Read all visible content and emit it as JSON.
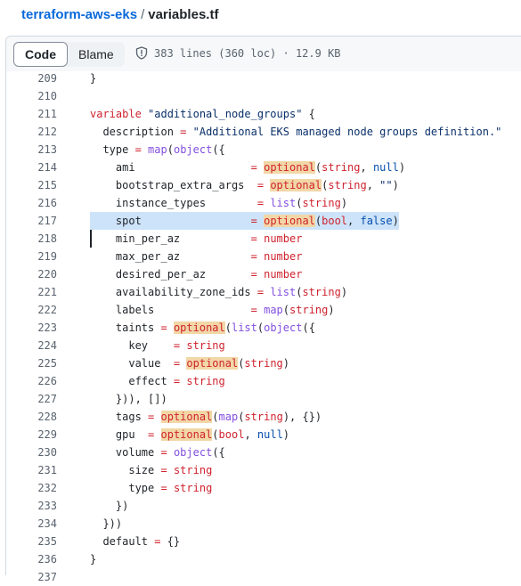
{
  "breadcrumb": {
    "repo": "terraform-aws-eks",
    "separator": "/",
    "file": "variables.tf"
  },
  "tabs": [
    {
      "label": "Code",
      "active": true
    },
    {
      "label": "Blame",
      "active": false
    }
  ],
  "file_meta": "383 lines (360 loc) · 12.9 KB",
  "highlighted_line": 217,
  "cursor_line": 218,
  "lines": [
    {
      "num": "209",
      "text": "}"
    },
    {
      "num": "210",
      "text": ""
    },
    {
      "num": "211",
      "text": "variable \"additional_node_groups\" {"
    },
    {
      "num": "212",
      "text": "  description = \"Additional EKS managed node groups definition.\""
    },
    {
      "num": "213",
      "text": "  type = map(object({"
    },
    {
      "num": "214",
      "text": "    ami                  = optional(string, null)"
    },
    {
      "num": "215",
      "text": "    bootstrap_extra_args  = optional(string, \"\")"
    },
    {
      "num": "216",
      "text": "    instance_types        = list(string)"
    },
    {
      "num": "217",
      "text": "    spot                 = optional(bool, false)"
    },
    {
      "num": "218",
      "text": "    min_per_az           = number"
    },
    {
      "num": "219",
      "text": "    max_per_az           = number"
    },
    {
      "num": "220",
      "text": "    desired_per_az       = number"
    },
    {
      "num": "221",
      "text": "    availability_zone_ids = list(string)"
    },
    {
      "num": "222",
      "text": "    labels               = map(string)"
    },
    {
      "num": "223",
      "text": "    taints = optional(list(object({"
    },
    {
      "num": "224",
      "text": "      key    = string"
    },
    {
      "num": "225",
      "text": "      value  = optional(string)"
    },
    {
      "num": "226",
      "text": "      effect = string"
    },
    {
      "num": "227",
      "text": "    })), [])"
    },
    {
      "num": "228",
      "text": "    tags = optional(map(string), {})"
    },
    {
      "num": "229",
      "text": "    gpu  = optional(bool, null)"
    },
    {
      "num": "230",
      "text": "    volume = object({"
    },
    {
      "num": "231",
      "text": "      size = string"
    },
    {
      "num": "232",
      "text": "      type = string"
    },
    {
      "num": "233",
      "text": "    })"
    },
    {
      "num": "234",
      "text": "  }))"
    },
    {
      "num": "235",
      "text": "  default = {}"
    },
    {
      "num": "236",
      "text": "}"
    },
    {
      "num": "237",
      "text": ""
    }
  ]
}
